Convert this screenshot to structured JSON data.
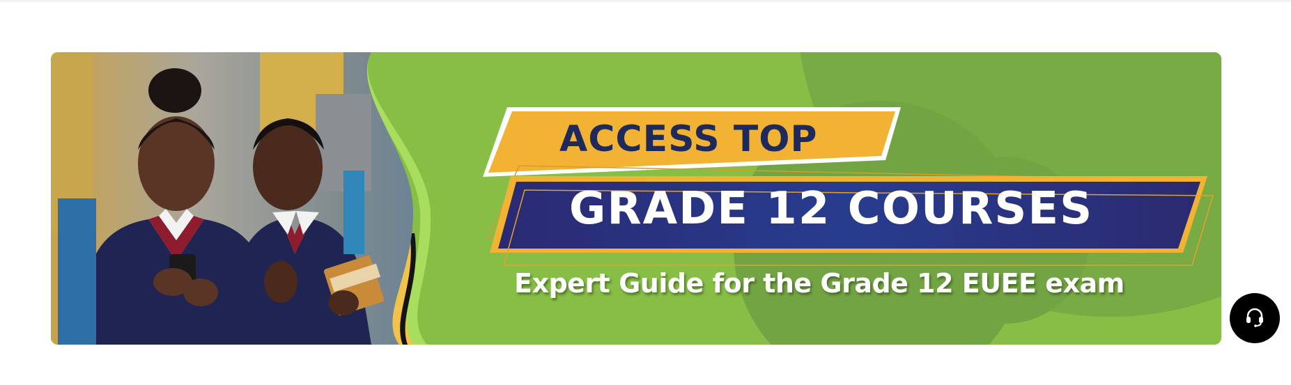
{
  "banner": {
    "headline_top": "ACCESS TOP",
    "headline_main": "GRADE 12 COURSES",
    "subtitle": "Expert Guide for the Grade 12 EUEE exam",
    "colors": {
      "background": "#86be46",
      "accent_yellow": "#f2b233",
      "navy": "#2b2b78",
      "headline_dark": "#1f2a5c"
    }
  },
  "support": {
    "icon": "headset-icon"
  }
}
